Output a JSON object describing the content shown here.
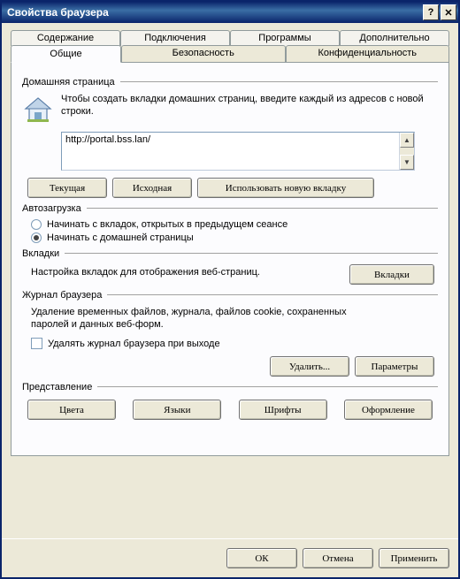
{
  "window": {
    "title": "Свойства браузера"
  },
  "tabs": {
    "row1": [
      "Содержание",
      "Подключения",
      "Программы",
      "Дополнительно"
    ],
    "row2": [
      "Общие",
      "Безопасность",
      "Конфиденциальность"
    ]
  },
  "homepage": {
    "group_label": "Домашняя страница",
    "description": "Чтобы создать вкладки домашних страниц, введите каждый из адресов с новой строки.",
    "url": "http://portal.bss.lan/",
    "btn_current": "Текущая",
    "btn_default": "Исходная",
    "btn_newtab": "Использовать новую вкладку"
  },
  "autostart": {
    "group_label": "Автозагрузка",
    "opt_last": "Начинать с вкладок, открытых в предыдущем сеансе",
    "opt_home": "Начинать с домашней страницы"
  },
  "tabs_section": {
    "group_label": "Вкладки",
    "description": "Настройка вкладок для отображения веб-страниц.",
    "btn": "Вкладки"
  },
  "history": {
    "group_label": "Журнал браузера",
    "description": "Удаление временных файлов, журнала, файлов cookie, сохраненных паролей и данных веб-форм.",
    "checkbox": "Удалять журнал браузера при выходе",
    "btn_delete": "Удалить...",
    "btn_params": "Параметры"
  },
  "appearance": {
    "group_label": "Представление",
    "btn_colors": "Цвета",
    "btn_lang": "Языки",
    "btn_fonts": "Шрифты",
    "btn_style": "Оформление"
  },
  "dialog_buttons": {
    "ok": "ОК",
    "cancel": "Отмена",
    "apply": "Применить"
  }
}
